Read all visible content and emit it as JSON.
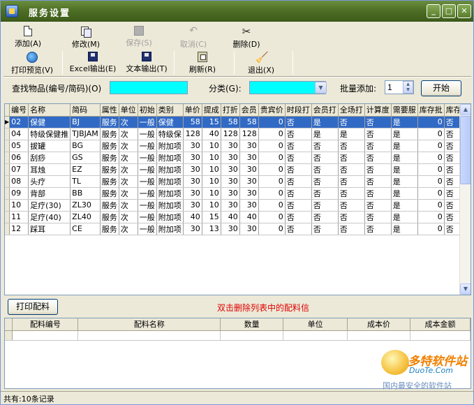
{
  "window": {
    "title": "服务设置"
  },
  "titlebar": {
    "min": "_",
    "max": "□",
    "close": "✕"
  },
  "toolbar": {
    "row1": [
      {
        "label": "添加(A)",
        "icon": "new-doc-icon",
        "enabled": true
      },
      {
        "label": "修改(M)",
        "icon": "edit-icon",
        "enabled": true
      },
      {
        "label": "保存(S)",
        "icon": "save-icon",
        "enabled": false
      },
      {
        "label": "取消(C)",
        "icon": "undo-icon",
        "enabled": false
      },
      {
        "label": "删除(D)",
        "icon": "scissors-icon",
        "enabled": true
      }
    ],
    "row2": [
      {
        "label": "打印预览(V)",
        "icon": "print-preview-icon",
        "enabled": true
      },
      {
        "label": "Excel输出(E)",
        "icon": "disk-icon",
        "enabled": true
      },
      {
        "label": "文本输出(T)",
        "icon": "disk-icon",
        "enabled": true
      },
      {
        "label": "刷新(R)",
        "icon": "refresh-icon",
        "enabled": true
      },
      {
        "label": "退出(X)",
        "icon": "exit-broom-icon",
        "enabled": true
      }
    ]
  },
  "search": {
    "find_label": "查找物品(编号/简码)(O)",
    "find_value": "",
    "category_label": "分类(G):",
    "category_value": "",
    "batch_label": "批量添加:",
    "batch_value": "1",
    "start_button": "开始"
  },
  "services_table": {
    "columns": [
      "编号",
      "名称",
      "简码",
      "属性",
      "单位",
      "初始",
      "类别",
      "单价",
      "提成",
      "打折",
      "会员",
      "贵宾价",
      "时段打",
      "会员打",
      "全场打",
      "计算度",
      "需要服",
      "库存批",
      "库存直"
    ],
    "rows": [
      [
        "02",
        "保健",
        "BJ",
        "服务",
        "次",
        "一般",
        "保健",
        "58",
        "15",
        "58",
        "58",
        "0",
        "否",
        "是",
        "否",
        "否",
        "是",
        "0",
        "否"
      ],
      [
        "04",
        "特级保健推",
        "TJBJAM",
        "服务",
        "次",
        "一般",
        "特级保",
        "128",
        "40",
        "128",
        "128",
        "0",
        "否",
        "是",
        "是",
        "否",
        "是",
        "0",
        "否"
      ],
      [
        "05",
        "拔罐",
        "BG",
        "服务",
        "次",
        "一般",
        "附加项",
        "30",
        "10",
        "30",
        "30",
        "0",
        "否",
        "否",
        "否",
        "否",
        "是",
        "0",
        "否"
      ],
      [
        "06",
        "刮痧",
        "GS",
        "服务",
        "次",
        "一般",
        "附加项",
        "30",
        "10",
        "30",
        "30",
        "0",
        "否",
        "否",
        "否",
        "否",
        "是",
        "0",
        "否"
      ],
      [
        "07",
        "耳烛",
        "EZ",
        "服务",
        "次",
        "一般",
        "附加项",
        "30",
        "10",
        "30",
        "30",
        "0",
        "否",
        "否",
        "否",
        "否",
        "是",
        "0",
        "否"
      ],
      [
        "08",
        "头疗",
        "TL",
        "服务",
        "次",
        "一般",
        "附加项",
        "30",
        "10",
        "30",
        "30",
        "0",
        "否",
        "否",
        "否",
        "否",
        "是",
        "0",
        "否"
      ],
      [
        "09",
        "背部",
        "BB",
        "服务",
        "次",
        "一般",
        "附加项",
        "30",
        "10",
        "30",
        "30",
        "0",
        "否",
        "否",
        "否",
        "否",
        "是",
        "0",
        "否"
      ],
      [
        "10",
        "足疗(30)",
        "ZL30",
        "服务",
        "次",
        "一般",
        "附加项",
        "30",
        "10",
        "30",
        "30",
        "0",
        "否",
        "否",
        "否",
        "否",
        "是",
        "0",
        "否"
      ],
      [
        "11",
        "足疗(40)",
        "ZL40",
        "服务",
        "次",
        "一般",
        "附加项",
        "40",
        "15",
        "40",
        "40",
        "0",
        "否",
        "否",
        "否",
        "否",
        "是",
        "0",
        "否"
      ],
      [
        "12",
        "踩耳",
        "CE",
        "服务",
        "次",
        "一般",
        "附加项",
        "30",
        "13",
        "30",
        "30",
        "0",
        "否",
        "否",
        "否",
        "否",
        "是",
        "0",
        "否"
      ]
    ]
  },
  "middle": {
    "print_button": "打印配料",
    "hint": "双击删除列表中的配料信"
  },
  "ingredients_table": {
    "columns": [
      "配料编号",
      "配料名称",
      "数量",
      "单位",
      "成本价",
      "成本金额"
    ]
  },
  "status": {
    "text": "共有:10条记录"
  },
  "watermark": {
    "big": "多特软件站",
    "sub": "DuoTe.Com",
    "caption": "国内最安全的软件站"
  },
  "colors": {
    "selection": "#316ac5",
    "search_fill": "#00ffff",
    "hint_red": "#e00000",
    "titlebar": "#4d6e25"
  }
}
